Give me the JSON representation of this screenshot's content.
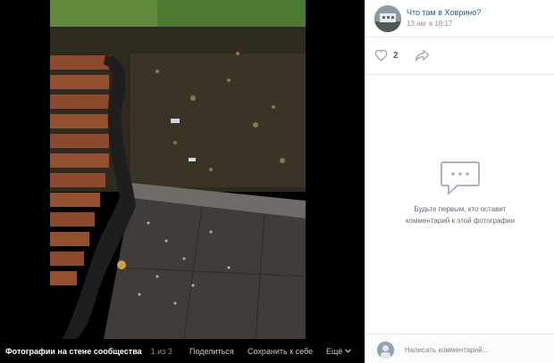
{
  "viewer": {
    "album_label": "Фотографии на стене сообщества",
    "counter": "1 из 3",
    "share_label": "Поделиться",
    "save_label": "Сохранить к себе",
    "more_label": "Ещё"
  },
  "post": {
    "author": "Что там в Ховрино?",
    "date": "13 авг в 18:17",
    "likes": "2"
  },
  "comments": {
    "empty_line1": "Будьте первым, кто оставит",
    "empty_line2": "комментарий к этой фотографии",
    "placeholder": "Написать комментарий..."
  },
  "colors": {
    "link": "#2a5885",
    "muted": "#939393",
    "icon": "#99a2ad"
  }
}
